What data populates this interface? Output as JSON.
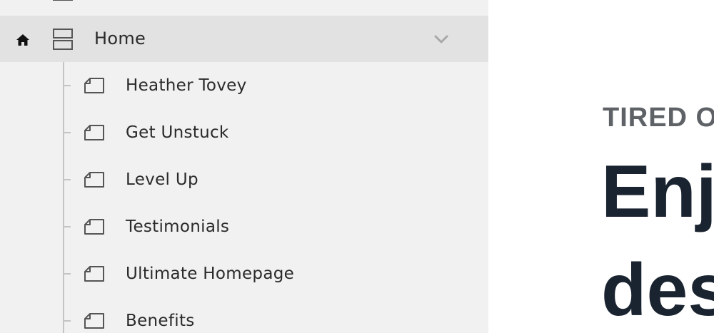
{
  "tree": {
    "home": {
      "label": "Home"
    },
    "pages": [
      {
        "label": "Heather Tovey"
      },
      {
        "label": "Get Unstuck"
      },
      {
        "label": "Level Up"
      },
      {
        "label": "Testimonials"
      },
      {
        "label": "Ultimate Homepage"
      },
      {
        "label": "Benefits"
      }
    ]
  },
  "preview": {
    "eyebrow": "TIRED O",
    "headline_line1": "Enj",
    "headline_line2": "des"
  },
  "icons": {
    "home": "home-icon",
    "folder": "folder-icon",
    "page": "page-icon",
    "chevron": "chevron-down-icon"
  },
  "colors": {
    "panel_bg": "#f1f1f1",
    "selected_row_bg": "#e2e2e2",
    "text": "#2a2a2a",
    "tree_line": "#c4c4c4",
    "preview_eyebrow": "#5e6266",
    "preview_headline": "#1a2330"
  }
}
